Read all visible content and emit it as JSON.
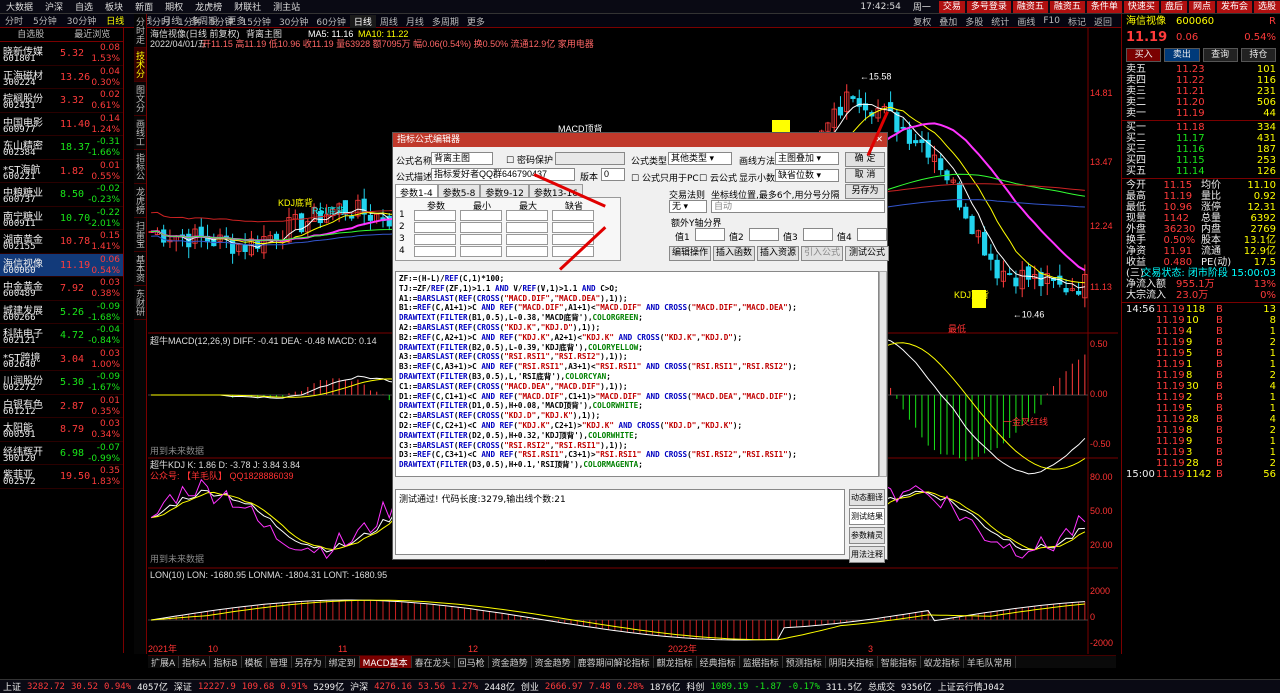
{
  "topbar": {
    "menus": [
      "大数据",
      "沪深",
      "自选",
      "板块",
      "新面",
      "期权",
      "龙虎榜",
      "财联社",
      "测主站"
    ],
    "time": "17:42:54",
    "weekday": "周一",
    "buttons": [
      "交易",
      "多号登录",
      "融资五",
      "融资五",
      "条件单",
      "快速买",
      "盘后",
      "网点",
      "发布会",
      "选股"
    ]
  },
  "tabs2": [
    "分时",
    "5分钟",
    "30分钟",
    "日线",
    "周线",
    "月线",
    "多周期",
    "更多"
  ],
  "left_header": [
    "自选股",
    "最近浏览"
  ],
  "stocks": [
    {
      "name": "晓新传媒",
      "code": "601801",
      "price": "5.32",
      "chg": "0.08",
      "pct": "1.53%",
      "dir": "up"
    },
    {
      "name": "正海磁材",
      "code": "300224",
      "price": "13.26",
      "chg": "0.04",
      "pct": "0.30%",
      "dir": "up"
    },
    {
      "name": "棕榈股份",
      "code": "002431",
      "price": "3.32",
      "chg": "0.02",
      "pct": "0.61%",
      "dir": "up"
    },
    {
      "name": "中国电影",
      "code": "600977",
      "price": "11.40",
      "chg": "0.14",
      "pct": "1.24%",
      "dir": "up"
    },
    {
      "name": "东山精密",
      "code": "002384",
      "price": "18.37",
      "chg": "-0.31",
      "pct": "-1.66%",
      "dir": "dn"
    },
    {
      "name": "*ST海航",
      "code": "600221",
      "price": "1.82",
      "chg": "0.01",
      "pct": "0.55%",
      "dir": "up"
    },
    {
      "name": "中粮糖业",
      "code": "600737",
      "price": "8.50",
      "chg": "-0.02",
      "pct": "-0.23%",
      "dir": "dn"
    },
    {
      "name": "南宁糖业",
      "code": "000911",
      "price": "10.70",
      "chg": "-0.22",
      "pct": "-2.01%",
      "dir": "dn"
    },
    {
      "name": "湖南黄金",
      "code": "002155",
      "price": "10.78",
      "chg": "0.15",
      "pct": "1.41%",
      "dir": "up"
    },
    {
      "name": "海信视像",
      "code": "600060",
      "price": "11.19",
      "chg": "0.06",
      "pct": "0.54%",
      "dir": "up"
    },
    {
      "name": "中金黄金",
      "code": "600489",
      "price": "7.92",
      "chg": "0.03",
      "pct": "0.38%",
      "dir": "up"
    },
    {
      "name": "城建发展",
      "code": "600266",
      "price": "5.26",
      "chg": "-0.09",
      "pct": "-1.68%",
      "dir": "dn"
    },
    {
      "name": "科陆电子",
      "code": "002121",
      "price": "4.72",
      "chg": "-0.04",
      "pct": "-0.84%",
      "dir": "dn"
    },
    {
      "name": "*ST跨境",
      "code": "002640",
      "price": "3.04",
      "chg": "0.03",
      "pct": "1.00%",
      "dir": "up"
    },
    {
      "name": "川润股份",
      "code": "002272",
      "price": "5.30",
      "chg": "-0.09",
      "pct": "-1.67%",
      "dir": "dn"
    },
    {
      "name": "白银有色",
      "code": "601212",
      "price": "2.87",
      "chg": "0.01",
      "pct": "0.35%",
      "dir": "up"
    },
    {
      "name": "太阳能",
      "code": "000591",
      "price": "8.79",
      "chg": "0.03",
      "pct": "0.34%",
      "dir": "up"
    },
    {
      "name": "经纬辉开",
      "code": "300120",
      "price": "6.98",
      "chg": "-0.07",
      "pct": "-0.99%",
      "dir": "dn"
    },
    {
      "name": "紫菲亚",
      "code": "002572",
      "price": "19.50",
      "chg": "0.35",
      "pct": "1.83%",
      "dir": "up"
    }
  ],
  "vtabs": [
    "分时走势",
    "技术分析",
    "图文分析",
    "画线工具",
    "指标公式",
    "龙虎榜",
    "扫雷宝",
    "基本资料",
    "东财研报"
  ],
  "period_tabs": [
    "分时",
    "1分钟",
    "5分钟",
    "15分钟",
    "30分钟",
    "60分钟",
    "日线",
    "周线",
    "月线",
    "多周期",
    "更多"
  ],
  "period_right": [
    "复权",
    "叠加",
    "多股",
    "统计",
    "画线",
    "F10",
    "标记",
    "返回"
  ],
  "chart_info": {
    "title": "海信视像(日线 前复权)",
    "formula": "背离主图",
    "ma5": "MA5: 11.16",
    "ma10": "MA10: 11.22",
    "date": "2022/04/01/五",
    "ohlc": "开11.15 高11.19 低10.96 收11.19 量63928 额7095万 幅0.06(0.54%) 换0.50% 流通12.9亿 家用电器"
  },
  "chart_labels": {
    "high": "15.58",
    "low": "10.46",
    "kdj_low": "KDJ底背",
    "rsi_low": "RSI底背",
    "kdj_top": "KDJ顶背",
    "rsi_top": "RSI顶背",
    "macd_top": "MACD顶背",
    "macd_low": "MACD底背",
    "bottom_label": "最低",
    "golden": "一金叉红线"
  },
  "price_axis": [
    "14.81",
    "13.47",
    "12.24",
    "11.13"
  ],
  "macd_info": "超牛MACD(12,26,9)  DIFF: -0.41  DEA: -0.48  MACD: 0.14",
  "macd_axis": [
    "0.50",
    "0.00",
    "-0.50"
  ],
  "kdj_info": "超牛KDJ  K: 1.86  D: -3.78  J: 3.84  3.84",
  "kdj_sub": "公众号: 【羊毛队】 QQ1828886039",
  "kdj_axis": [
    "80.00",
    "50.00",
    "20.00"
  ],
  "lon_info": "LON(10)  LON: -1680.95  LONMA: -1804.31  LONT: -1680.95",
  "lon_axis": [
    "2000",
    "0",
    "-2000"
  ],
  "macd_note": "用到未来数据",
  "kdj_note": "用到未来数据",
  "year_labels": [
    "2021年",
    "10",
    "11",
    "12",
    "2022年",
    "3"
  ],
  "dialog": {
    "title": "指标公式编辑器",
    "name_label": "公式名称",
    "name_value": "背离主图",
    "pwd_label": "密码保护",
    "desc_label": "公式描述",
    "desc_value": "指标爱好者QQ群646790437",
    "ver_label": "版本",
    "ver_value": "0",
    "type_label": "公式类型",
    "type_value": "其他类型",
    "draw_label": "画线方法",
    "draw_value": "主图叠加",
    "pc_label": "公式只用于PC",
    "cloud_label": "云公式",
    "dec_label": "显示小数",
    "dec_value": "缺省位数",
    "ok": "确 定",
    "cancel": "取 消",
    "saveas": "另存为",
    "param_tabs": [
      "参数1-4",
      "参数5-8",
      "参数9-12",
      "参数13-16"
    ],
    "param_cols": [
      "参数",
      "最小",
      "最大",
      "缺省"
    ],
    "param_rows": [
      "1",
      "2",
      "3",
      "4"
    ],
    "trade_label": "交易法则",
    "axis_label": "坐标线位置,最多6个,用分号分隔",
    "trade_value": "无",
    "axis_value": "自动",
    "extra_label": "额外Y轴分界",
    "lines": [
      "值1",
      "值2",
      "值3",
      "值4"
    ],
    "btns": [
      "编辑操作",
      "插入函数",
      "插入资源",
      "引入公式",
      "测试公式"
    ],
    "code": [
      "ZF:=(H-L)/REF(C,1)*100;",
      "TJ:=ZF/REF(ZF,1)>1.1 AND V/REF(V,1)>1.1 AND C>O;",
      "A1:=BARSLAST(REF(CROSS(\"MACD.DIF\",\"MACD.DEA\"),1));",
      "B1:=REF(C,A1+1)>C AND REF(\"MACD.DIF\",A1+1)<\"MACD.DIF\" AND CROSS(\"MACD.DIF\",\"MACD.DEA\");",
      "DRAWTEXT(FILTER(B1,0.5),L-0.38,'MACD底背'),COLORGREEN;",
      "A2:=BARSLAST(REF(CROSS(\"KDJ.K\",\"KDJ.D\"),1));",
      "B2:=REF(C,A2+1)>C AND REF(\"KDJ.K\",A2+1)<\"KDJ.K\" AND CROSS(\"KDJ.K\",\"KDJ.D\");",
      "DRAWTEXT(FILTER(B2,0.5),L-0.39,'KDJ底背'),COLORYELLOW;",
      "A3:=BARSLAST(REF(CROSS(\"RSI.RSI1\",\"RSI.RSI2\"),1));",
      "B3:=REF(C,A3+1)>C AND REF(\"RSI.RSI1\",A3+1)<\"RSI.RSI1\" AND CROSS(\"RSI.RSI1\",\"RSI.RSI2\");",
      "DRAWTEXT(FILTER(B3,0.5),L,'RSI底背'),COLORCYAN;",
      "C1:=BARSLAST(REF(CROSS(\"MACD.DEA\",\"MACD.DIF\"),1));",
      "D1:=REF(C,C1+1)<C AND REF(\"MACD.DIF\",C1+1)>\"MACD.DIF\" AND CROSS(\"MACD.DEA\",\"MACD.DIF\");",
      "DRAWTEXT(FILTER(D1,0.5),H+0.08,'MACD顶背'),COLORWHITE;",
      "C2:=BARSLAST(REF(CROSS(\"KDJ.D\",\"KDJ.K\"),1));",
      "D2:=REF(C,C2+1)<C AND REF(\"KDJ.K\",C2+1)>\"KDJ.K\" AND CROSS(\"KDJ.D\",\"KDJ.K\");",
      "DRAWTEXT(FILTER(D2,0.5),H+0.32,'KDJ顶背'),COLORWHITE;",
      "C3:=BARSLAST(REF(CROSS(\"RSI.RSI2\",\"RSI.RSI1\"),1));",
      "D3:=REF(C,C3+1)<C AND REF(\"RSI.RSI1\",C3+1)>\"RSI.RSI1\" AND CROSS(\"RSI.RSI2\",\"RSI.RSI1\");",
      "DRAWTEXT(FILTER(D3,0.5),H+0.1,'RSI顶背'),COLORMAGENTA;"
    ],
    "result": "测试通过! 代码长度:3279,输出线个数:21",
    "side_btns": [
      "动态翻译",
      "测试结果",
      "参数精灵",
      "用法注释"
    ]
  },
  "quote": {
    "name": "海信视像",
    "code": "600060",
    "tag": "R",
    "price": "11.19",
    "chg": "0.06",
    "pct": "0.54%",
    "trade_btns": [
      "买入",
      "卖出",
      "查询",
      "持仓"
    ],
    "asks": [
      [
        "卖五",
        "11.23",
        "101"
      ],
      [
        "卖四",
        "11.22",
        "116"
      ],
      [
        "卖三",
        "11.21",
        "231"
      ],
      [
        "卖二",
        "11.20",
        "506"
      ],
      [
        "卖一",
        "11.19",
        "44"
      ]
    ],
    "bids": [
      [
        "买一",
        "11.18",
        "334"
      ],
      [
        "买二",
        "11.17",
        "431"
      ],
      [
        "买三",
        "11.16",
        "187"
      ],
      [
        "买四",
        "11.15",
        "253"
      ],
      [
        "买五",
        "11.14",
        "126"
      ]
    ],
    "stats": [
      [
        "今开",
        "11.15",
        "均价",
        "11.10"
      ],
      [
        "最高",
        "11.19",
        "量比",
        "0.92"
      ],
      [
        "最低",
        "10.96",
        "涨停",
        "12.31"
      ],
      [
        "现量",
        "1142",
        "总量",
        "6392"
      ],
      [
        "外盘",
        "36230",
        "内盘",
        "2769"
      ],
      [
        "换手",
        "0.50%",
        "股本",
        "13.1亿"
      ],
      [
        "净资",
        "11.91",
        "流通",
        "12.9亿"
      ],
      [
        "收益(三)",
        "0.480",
        "PE(动)",
        "17.5"
      ]
    ],
    "status": "交易状态: 闭市阶段 15:00:03",
    "flow1": [
      "净流入额",
      "955.1万",
      "13%"
    ],
    "flow2": [
      "大宗流入",
      "23.0万",
      "0%"
    ],
    "ticks": [
      [
        "14:56",
        "11.19",
        "118",
        "13"
      ],
      [
        "",
        "11.19",
        "10",
        "8"
      ],
      [
        "",
        "11.19",
        "4",
        "1"
      ],
      [
        "",
        "11.19",
        "9",
        "2"
      ],
      [
        "",
        "11.19",
        "5",
        "1"
      ],
      [
        "",
        "11.19",
        "1",
        "1"
      ],
      [
        "",
        "11.19",
        "8",
        "2"
      ],
      [
        "",
        "11.19",
        "30",
        "4"
      ],
      [
        "",
        "11.19",
        "2",
        "1"
      ],
      [
        "",
        "11.19",
        "5",
        "1"
      ],
      [
        "",
        "11.19",
        "28",
        "4"
      ],
      [
        "",
        "11.19",
        "8",
        "2"
      ],
      [
        "",
        "11.19",
        "9",
        "1"
      ],
      [
        "",
        "11.19",
        "3",
        "1"
      ],
      [
        "",
        "11.19",
        "28",
        "2"
      ],
      [
        "15:00",
        "11.19",
        "1142",
        "56"
      ]
    ]
  },
  "indicator_tabs": [
    "扩展A",
    "指标A",
    "指标B",
    "模板",
    "管理",
    "另存为",
    "绑定到",
    "MACD基本",
    "春在龙头",
    "回马枪",
    "资金趋势",
    "资金趋势",
    "鹿蓉期间解论指标",
    "麒龙指标",
    "经典指标",
    "监据指标",
    "预测指标",
    "阴阳关指标",
    "智能指标",
    "蚁龙指标",
    "羊毛队常用"
  ],
  "bottom_bar": [
    {
      "label": "上证",
      "v": "3282.72",
      "c": "30.52",
      "p": "0.94%",
      "vol": "4057亿",
      "dir": "up"
    },
    {
      "label": "深证",
      "v": "12227.9",
      "c": "109.68",
      "p": "0.91%",
      "vol": "5299亿",
      "dir": "up"
    },
    {
      "label": "沪深",
      "v": "4276.16",
      "c": "53.56",
      "p": "1.27%",
      "vol": "2448亿",
      "dir": "up"
    },
    {
      "label": "创业",
      "v": "2666.97",
      "c": "7.48",
      "p": "0.28%",
      "vol": "1876亿",
      "dir": "up"
    },
    {
      "label": "科创",
      "v": "1089.19",
      "c": "-1.87",
      "p": "-0.17%",
      "vol": "311.5亿",
      "dir": "dn"
    }
  ],
  "bottom_right": [
    "总成交",
    "9356亿",
    "上证云行情J042"
  ]
}
